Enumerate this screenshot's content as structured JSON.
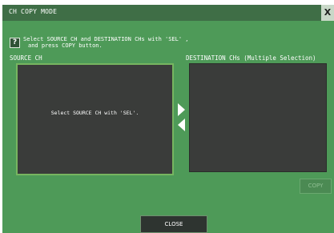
{
  "window": {
    "title": "CH COPY MODE",
    "close_symbol": "X"
  },
  "instructions": {
    "help_symbol": "?",
    "line1": "Select SOURCE CH and DESTINATION CHs with 'SEL' ,",
    "line2": "and press COPY button."
  },
  "source": {
    "label": "SOURCE CH",
    "message": "Select SOURCE CH with 'SEL'."
  },
  "destination": {
    "label": "DESTINATION CHs (Multiple Selection)"
  },
  "buttons": {
    "copy": "COPY",
    "close": "CLOSE"
  },
  "icons": {
    "close": "close-icon",
    "help": "help-icon",
    "arrow_right": "arrow-right-icon",
    "arrow_left": "arrow-left-icon"
  },
  "colors": {
    "background": "#4e9a58",
    "titlebar": "#3f6e46",
    "panel": "#3a3c3a",
    "selected_border": "#77b560"
  }
}
